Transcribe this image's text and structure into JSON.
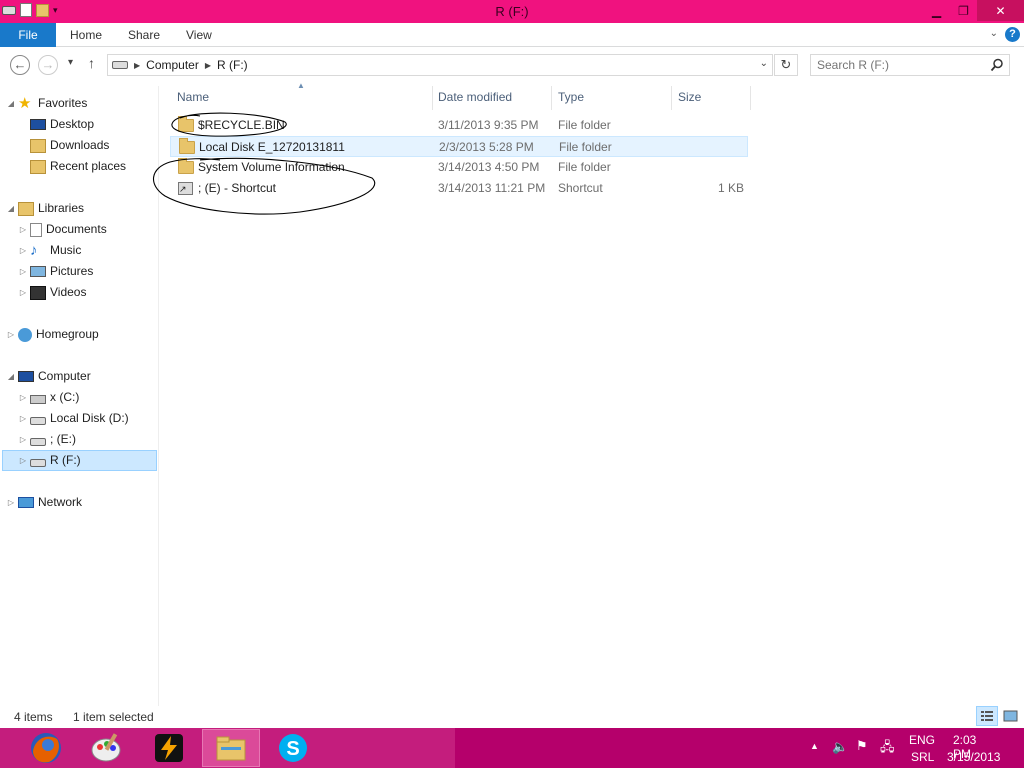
{
  "window": {
    "title": "R (F:)",
    "accent_color": "#f0127f",
    "controls": [
      "minimize",
      "maximize",
      "close"
    ]
  },
  "ribbon": {
    "tabs": [
      {
        "label": "File"
      },
      {
        "label": "Home"
      },
      {
        "label": "Share"
      },
      {
        "label": "View"
      }
    ],
    "help_label": "?"
  },
  "address": {
    "crumbs": [
      "Computer",
      "R (F:)"
    ]
  },
  "search": {
    "placeholder": "Search R (F:)"
  },
  "navpane": {
    "favorites": {
      "label": "Favorites",
      "items": [
        "Desktop",
        "Downloads",
        "Recent places"
      ]
    },
    "libraries": {
      "label": "Libraries",
      "items": [
        "Documents",
        "Music",
        "Pictures",
        "Videos"
      ]
    },
    "homegroup": {
      "label": "Homegroup"
    },
    "computer": {
      "label": "Computer",
      "items": [
        "x (C:)",
        "Local Disk (D:)",
        "; (E:)",
        "R (F:)"
      ]
    },
    "network": {
      "label": "Network"
    }
  },
  "columns": {
    "name": "Name",
    "date": "Date modified",
    "type": "Type",
    "size": "Size"
  },
  "files": [
    {
      "name": "$RECYCLE.BIN",
      "date": "3/11/2013 9:35 PM",
      "type": "File folder",
      "size": "",
      "icon": "folder-icon"
    },
    {
      "name": "Local Disk E_12720131811",
      "date": "2/3/2013 5:28 PM",
      "type": "File folder",
      "size": "",
      "icon": "folder-icon"
    },
    {
      "name": "System Volume Information",
      "date": "3/14/2013 4:50 PM",
      "type": "File folder",
      "size": "",
      "icon": "folder-icon"
    },
    {
      "name": "; (E) - Shortcut",
      "date": "3/14/2013 11:21 PM",
      "type": "Shortcut",
      "size": "1 KB",
      "icon": "shortcut-icon"
    }
  ],
  "status": {
    "count": "4 items",
    "selection": "1 item selected"
  },
  "taskbar": {
    "apps": [
      "firefox-icon",
      "paint-icon",
      "winamp-icon",
      "file-explorer-icon",
      "skype-icon"
    ],
    "language": "ENG",
    "layout": "SRL",
    "time": "2:03 PM",
    "date": "3/15/2013"
  }
}
